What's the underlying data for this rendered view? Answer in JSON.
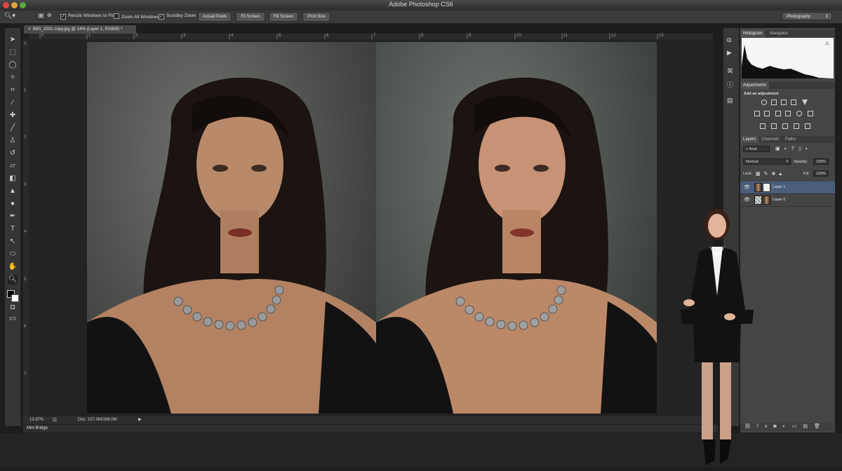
{
  "window": {
    "title": "Adobe Photoshop CS6"
  },
  "options_bar": {
    "resize_windows_label": "Resize Windows to Fit",
    "zoom_all_windows_label": "Zoom All Windows",
    "scrubby_zoom_label": "Scrubby Zoom",
    "actual_pixels_label": "Actual Pixels",
    "fit_screen_label": "Fit Screen",
    "fill_screen_label": "Fill Screen",
    "print_size_label": "Print Size",
    "workspace": "Photography"
  },
  "document": {
    "tab_title": "IMG_2201 copy.jpg @ 14% (Layer 1, RGB/8) *",
    "zoom": "13.97%",
    "doc_size": "Doc: 157.0M/168.0M",
    "ruler_h_numbers": [
      "0",
      "1",
      "2",
      "3",
      "4",
      "5",
      "6",
      "7",
      "8",
      "9",
      "10",
      "11",
      "12",
      "13"
    ],
    "ruler_v_numbers": [
      "0",
      "1",
      "2",
      "3",
      "4",
      "5",
      "6",
      "7"
    ]
  },
  "panels": {
    "histogram_tab": "Histogram",
    "navigator_tab": "Navigator",
    "adjustments_tab": "Adjustments",
    "add_adjustment_label": "Add an adjustment",
    "layers_tab": "Layers",
    "channels_tab": "Channels",
    "paths_tab": "Paths",
    "filter_kind": "Kind",
    "blend_mode": "Normal",
    "opacity_label": "Opacity:",
    "opacity_value": "100%",
    "lock_label": "Lock:",
    "fill_label": "Fill:",
    "fill_value": "100%",
    "layers": [
      {
        "name": "Layer 1"
      },
      {
        "name": "Layer 0"
      }
    ]
  },
  "mini_bridge": {
    "label": "Mini Bridge"
  },
  "colors": {
    "selection_blue": "#4a5d7a",
    "panel_bg": "#454545",
    "app_bg": "#1d1d1d"
  }
}
